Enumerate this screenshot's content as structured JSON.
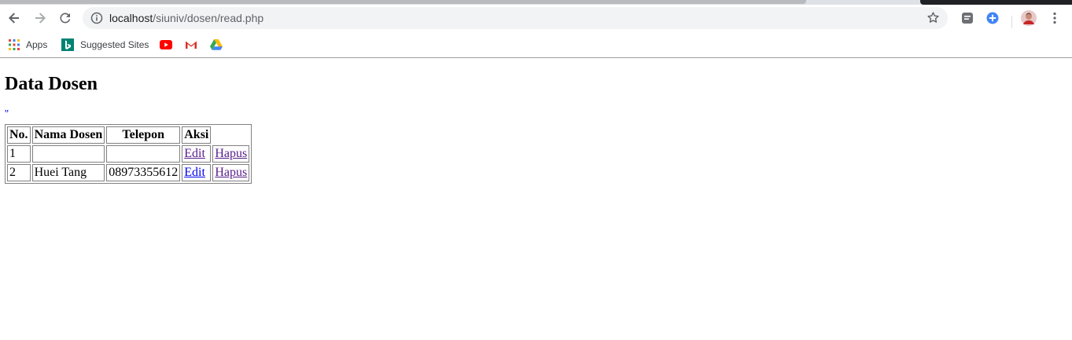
{
  "browser": {
    "url_host": "localhost",
    "url_path": "/siuniv/dosen/read.php",
    "bookmarks": [
      {
        "label": "Apps",
        "icon": "apps-grid-icon"
      },
      {
        "label": "Suggested Sites",
        "icon": "bing-icon"
      },
      {
        "label": "",
        "icon": "youtube-icon"
      },
      {
        "label": "",
        "icon": "gmail-icon"
      },
      {
        "label": "",
        "icon": "google-drive-icon"
      }
    ]
  },
  "page": {
    "title": "Data Dosen",
    "stray_text": "''",
    "table": {
      "headers": [
        "No.",
        "Nama Dosen",
        "Telepon",
        "Aksi",
        ""
      ],
      "rows": [
        {
          "no": "1",
          "nama": "",
          "telepon": "",
          "edit": "Edit",
          "hapus": "Hapus"
        },
        {
          "no": "2",
          "nama": "Huei Tang",
          "telepon": "08973355612",
          "edit": "Edit",
          "hapus": "Hapus"
        }
      ]
    }
  },
  "colors": {
    "link_visited": "#551a8b",
    "link_unvisited": "#0000ee",
    "omnibox_bg": "#f1f3f4"
  }
}
